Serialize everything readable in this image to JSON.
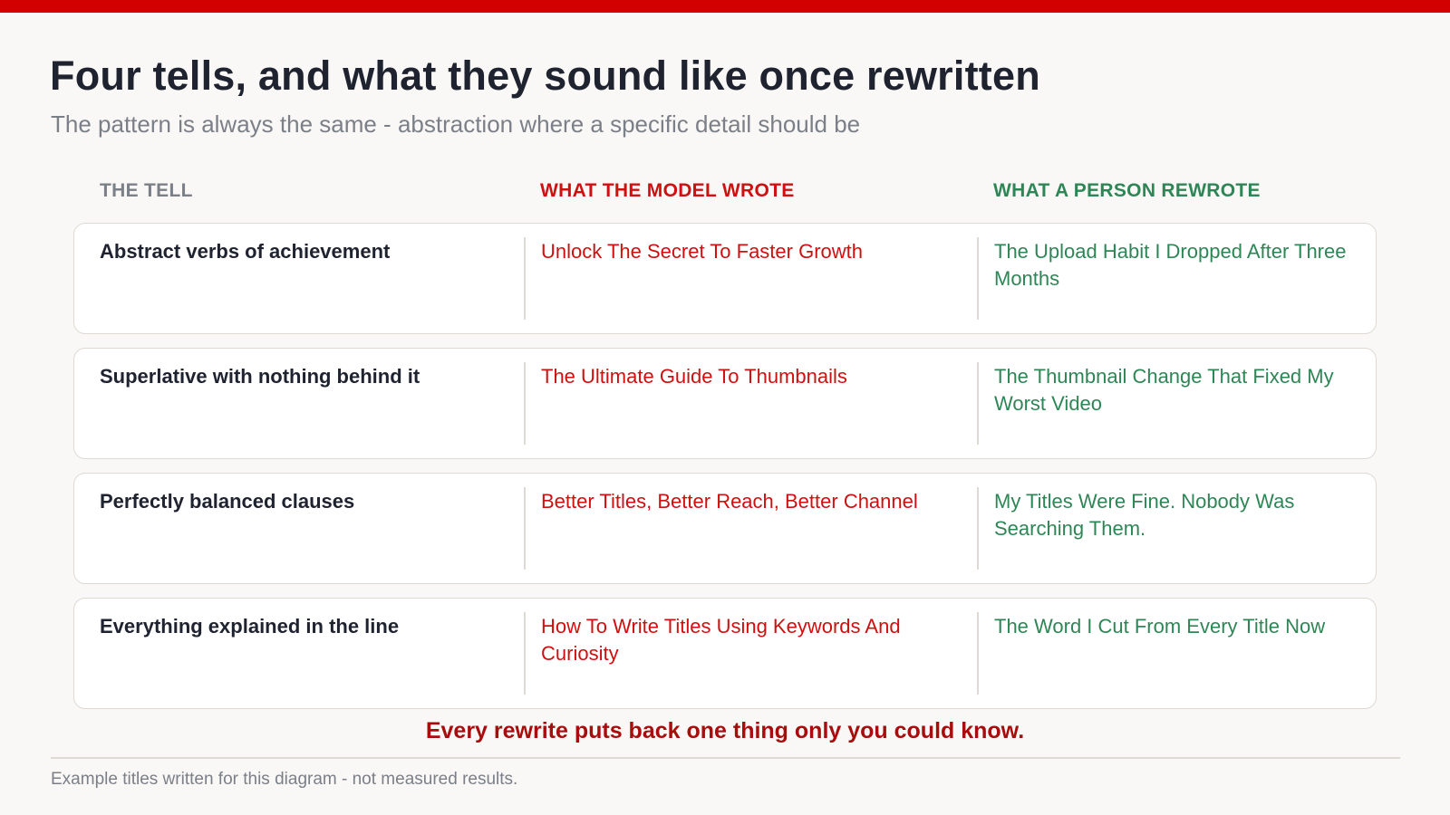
{
  "header": {
    "title": "Four tells, and what they sound like once rewritten",
    "subtitle": "The pattern is always the same - abstraction where a specific detail should be"
  },
  "columns": {
    "tell": "THE TELL",
    "model": "WHAT THE MODEL WROTE",
    "person": "WHAT A PERSON REWROTE"
  },
  "rows": [
    {
      "tell": "Abstract verbs of achievement",
      "model": "Unlock The Secret To Faster Growth",
      "person": "The Upload Habit I Dropped After Three Months"
    },
    {
      "tell": "Superlative with nothing behind it",
      "model": "The Ultimate Guide To Thumbnails",
      "person": "The Thumbnail Change That Fixed My Worst Video"
    },
    {
      "tell": "Perfectly balanced clauses",
      "model": "Better Titles, Better Reach, Better Channel",
      "person": "My Titles Were Fine. Nobody Was Searching Them."
    },
    {
      "tell": "Everything explained in the line",
      "model": "How To Write Titles Using Keywords And Curiosity",
      "person": "The Word I Cut From Every Title Now"
    }
  ],
  "conclusion": "Every rewrite puts back one thing only you could know.",
  "footnote": "Example titles written for this diagram - not measured results.",
  "colors": {
    "accent_red": "#d20000",
    "model_red": "#cf1010",
    "person_green": "#2e8656",
    "conclusion_red": "#a80c0c"
  }
}
